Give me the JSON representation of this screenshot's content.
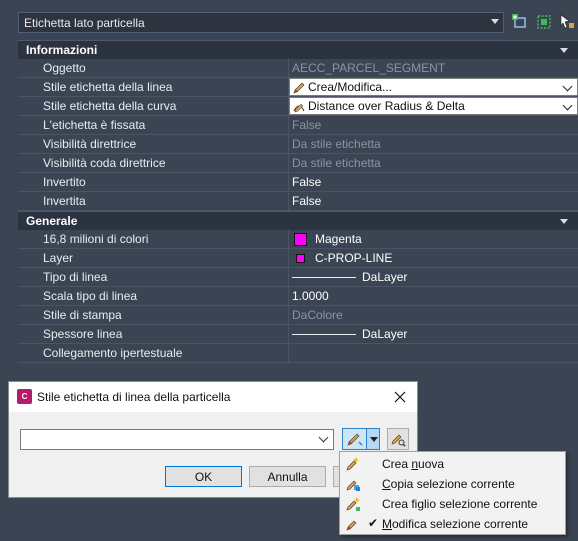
{
  "topbar": {
    "selector_value": "Etichetta lato particella"
  },
  "sections": [
    {
      "title": "Informazioni",
      "rows": [
        {
          "label": "Oggetto",
          "value": "AECC_PARCEL_SEGMENT",
          "dim": true
        },
        {
          "label": "Stile etichetta della linea",
          "value": "Crea/Modifica...",
          "combo": true
        },
        {
          "label": "Stile etichetta della curva",
          "value": "Distance over Radius & Delta",
          "combo": true
        },
        {
          "label": "L'etichetta è fissata",
          "value": "False",
          "dim": true
        },
        {
          "label": "Visibilità direttrice",
          "value": "Da stile etichetta",
          "dim": true
        },
        {
          "label": "Visibilità coda direttrice",
          "value": "Da stile etichetta",
          "dim": true
        },
        {
          "label": "Invertito",
          "value": "False"
        },
        {
          "label": "Invertita",
          "value": "False"
        }
      ]
    },
    {
      "title": "Generale",
      "rows": [
        {
          "label": "16,8 milioni di colori",
          "value": "Magenta",
          "swatch": "big"
        },
        {
          "label": "Layer",
          "value": "C-PROP-LINE",
          "swatch": "small"
        },
        {
          "label": "Tipo di linea",
          "value": "DaLayer",
          "line": true
        },
        {
          "label": "Scala tipo di linea",
          "value": "1.0000"
        },
        {
          "label": "Stile di stampa",
          "value": "DaColore",
          "dim": true
        },
        {
          "label": "Spessore linea",
          "value": "DaLayer",
          "line": true
        },
        {
          "label": "Collegamento ipertestuale",
          "value": ""
        }
      ]
    }
  ],
  "colors": {
    "magenta": "#ff00ff",
    "panel_bg": "#3b4453",
    "section_bg": "#2b3240"
  },
  "dialog": {
    "title": "Stile etichetta di linea della particella",
    "app_icon_text": "C 3D",
    "combo_value": "",
    "ok_label": "OK",
    "cancel_label": "Annulla",
    "help_label": ""
  },
  "menu": {
    "items": [
      {
        "pre": "Crea ",
        "ul": "n",
        "post": "uova",
        "checked": false
      },
      {
        "pre": "",
        "ul": "C",
        "post": "opia selezione corrente",
        "checked": false
      },
      {
        "pre": "Crea figlio selezione corrente",
        "ul": "",
        "post": "",
        "checked": false
      },
      {
        "pre": "",
        "ul": "M",
        "post": "odifica selezione corrente",
        "checked": true
      }
    ]
  }
}
